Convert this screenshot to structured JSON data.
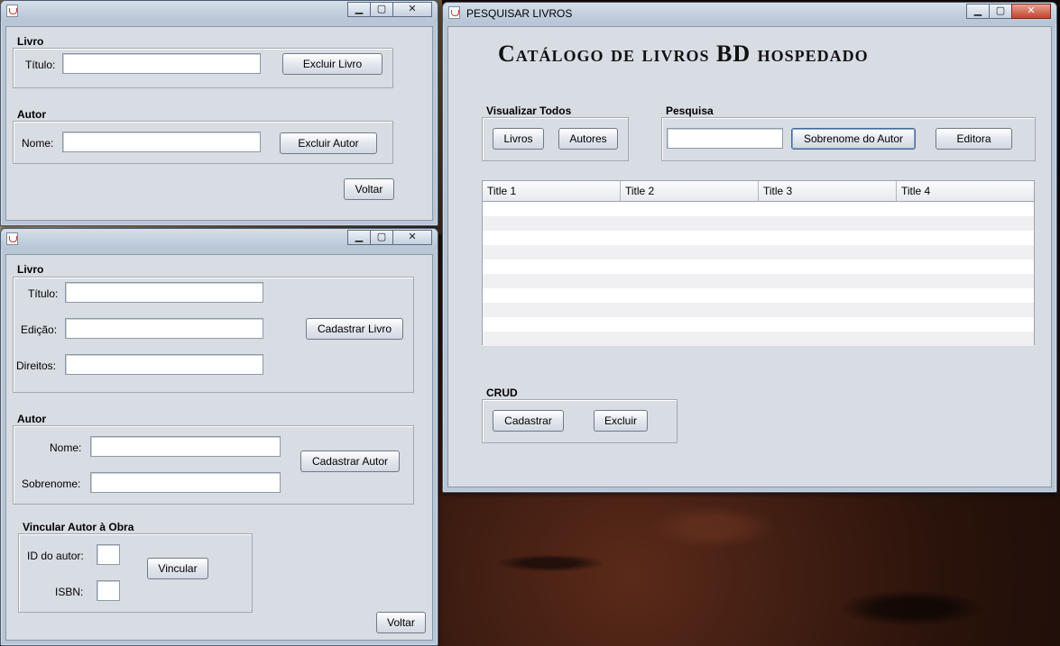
{
  "win_excluir": {
    "group_livro": "Livro",
    "titulo_label": "Título:",
    "titulo_value": "",
    "excluir_livro_btn": "Excluir Livro",
    "group_autor": "Autor",
    "nome_label": "Nome:",
    "nome_value": "",
    "excluir_autor_btn": "Excluir Autor",
    "voltar_btn": "Voltar"
  },
  "win_cadastro": {
    "group_livro": "Livro",
    "titulo_label": "Título:",
    "edicao_label": "Edição:",
    "direitos_label": "Direitos:",
    "cadastrar_livro_btn": "Cadastrar Livro",
    "group_autor": "Autor",
    "nome_label": "Nome:",
    "sobrenome_label": "Sobrenome:",
    "cadastrar_autor_btn": "Cadastrar Autor",
    "group_vincular": "Vincular Autor à Obra",
    "id_autor_label": "ID do autor:",
    "isbn_label": "ISBN:",
    "vincular_btn": "Vincular",
    "voltar_btn": "Voltar"
  },
  "win_pesquisar": {
    "title": "PESQUISAR LIVROS",
    "heading": "Catálogo de livros BD hospedado",
    "group_visualizar": "Visualizar Todos",
    "livros_btn": "Livros",
    "autores_btn": "Autores",
    "group_pesquisa": "Pesquisa",
    "pesquisa_value": "",
    "sobrenome_btn": "Sobrenome do Autor",
    "editora_btn": "Editora",
    "table_headers": [
      "Title 1",
      "Title 2",
      "Title 3",
      "Title 4"
    ],
    "group_crud": "CRUD",
    "cadastrar_btn": "Cadastrar",
    "excluir_btn": "Excluir"
  },
  "caption": {
    "minimize": "▁",
    "maximize": "▢",
    "close": "✕"
  }
}
